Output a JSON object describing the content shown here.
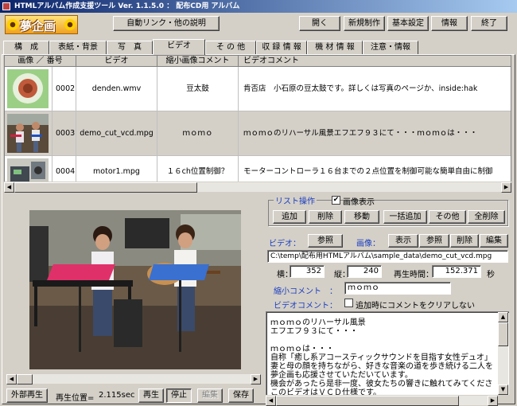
{
  "window": {
    "title": "HTMLアルバム作成支援ツール  Ver. 1.1.5.0 ： 配布CD用 アルバム"
  },
  "logo": {
    "text": "夢企画"
  },
  "toolbar": {
    "auto_link": "自動リンク・他の説明",
    "open": "開く",
    "new": "新規制作",
    "settings": "基本設定",
    "info": "情報",
    "exit": "終了"
  },
  "tabs": [
    "構　成",
    "表紙・背景",
    "写　真",
    "ビデオ",
    "そ の 他",
    "収 録 情 報",
    "機 材 情 報",
    "注意・情報"
  ],
  "active_tab": 3,
  "grid": {
    "headers": [
      "画像 ／ 番号",
      "ビデオ",
      "縮小画像コメント",
      "ビデオコメント"
    ],
    "rows": [
      {
        "num": "0002",
        "video": "denden.wmv",
        "thumb_comment": "豆太鼓",
        "comment": "肯否店　小石原の豆太鼓です。詳しくは写真のページか、inside:hak"
      },
      {
        "num": "0003",
        "video": "demo_cut_vcd.mpg",
        "thumb_comment": "ｍｏｍｏ",
        "comment": "ｍｏｍｏのリハーサル風景エフエフ９３にて・・・ｍｏｍｏは・・・"
      },
      {
        "num": "0004",
        "video": "motor1.mpg",
        "thumb_comment": "１６ch位置制御？",
        "comment": "モーターコントローラ１６台までの２点位置を制御可能な簡単自由に制御"
      }
    ],
    "selected_row": 1
  },
  "list_ops": {
    "label": "リスト操作",
    "show_image_label": "画像表示",
    "show_image_checked": true,
    "add": "追加",
    "delete": "削除",
    "move": "移動",
    "bulk_add": "一括追加",
    "other": "その他",
    "delete_all": "全削除"
  },
  "video_section": {
    "video_label": "ビデオ：",
    "browse": "参照",
    "image_label": "画像：",
    "show": "表示",
    "browse2": "参照",
    "delete": "削除",
    "edit": "編集",
    "path": "C:\\temp\\配布用HTMLアルバム\\sample_data\\demo_cut_vcd.mpg",
    "width_label": "横：",
    "width": "352",
    "height_label": "縦：",
    "height": "240",
    "duration_label": "再生時間：",
    "duration": "152.371",
    "duration_unit": "秒",
    "thumb_comment_label": "縮小コメント　：",
    "thumb_comment": "ｍｏｍｏ",
    "video_comment_label": "ビデオコメント：",
    "clear_on_add_label": "追加時にコメントをクリアしない",
    "clear_on_add_checked": false
  },
  "comment_lines": [
    "ｍｏｍｏのリハーサル風景",
    "エフエフ９３にて・・・",
    "",
    "ｍｏｍｏは・・・",
    "自称「癒し系アコースティックサウンドを目指す女性デュオ」",
    "妻と母の顔を持ちながら、好きな音楽の道を歩き続ける二人を",
    "夢企画も応援させていただいています。",
    "機会があったら是非一度、彼女たちの響きに触れてみてくださ",
    "このビデオはＶＣＤ仕様です。"
  ],
  "player": {
    "external_play": "外部再生",
    "position_label": "再生位置=",
    "position": "2.115sec",
    "play": "再生",
    "stop": "停止",
    "edit": "編集",
    "save": "保存"
  }
}
